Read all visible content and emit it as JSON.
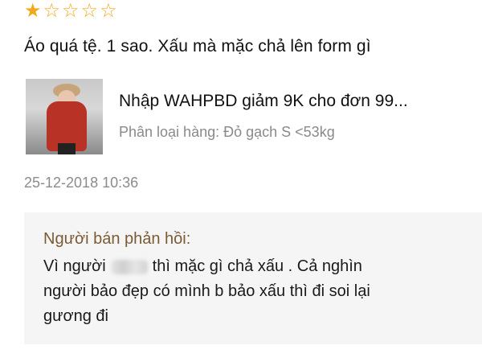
{
  "rating": {
    "filled": 1,
    "total": 5
  },
  "review": {
    "text": "Áo quá tệ. 1 sao. Xấu mà mặc chả lên form gì"
  },
  "product": {
    "title": "Nhập WAHPBD giảm 9K cho đơn 99...",
    "variant": "Phân loại hàng: Đỏ gạch S <53kg"
  },
  "timestamp": "25-12-2018 10:36",
  "seller_reply": {
    "header": "Người bán phản hồi:",
    "line1_before": "Vì người",
    "line1_after": "thì mặc gì chả xấu . Cả nghìn",
    "line2": "người bảo đẹp có mình b bảo xấu thì đi soi lại",
    "line3": "gương đi"
  },
  "colors": {
    "star": "#f2a81c",
    "reply_header": "#7b5b34",
    "reply_bg": "#f5f5f5"
  }
}
